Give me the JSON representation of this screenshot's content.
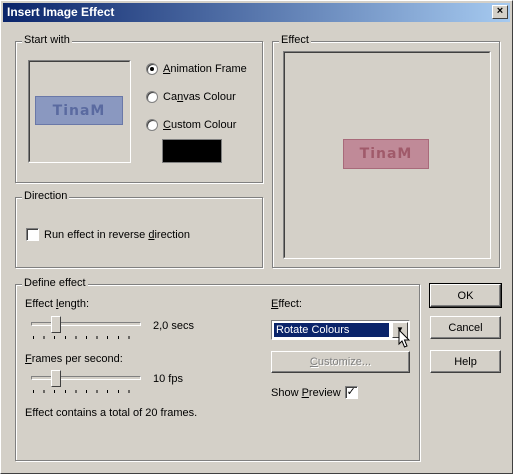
{
  "window": {
    "title": "Insert Image Effect",
    "close_label": "×"
  },
  "start_with": {
    "group_label": "Start with",
    "preview_logo": "TinaM",
    "options": [
      {
        "pre": "",
        "key": "A",
        "post": "nimation Frame",
        "checked": true
      },
      {
        "pre": "Ca",
        "key": "n",
        "post": "vas Colour",
        "checked": false
      },
      {
        "pre": "",
        "key": "C",
        "post": "ustom Colour",
        "checked": false
      }
    ],
    "custom_colour": "#000000"
  },
  "effect_panel": {
    "group_label": "Effect",
    "preview_logo": "TinaM"
  },
  "direction": {
    "group_label": "Direction",
    "reverse_pre": "Run effect in reverse ",
    "reverse_key": "d",
    "reverse_post": "irection",
    "reverse_checked": false
  },
  "define_effect": {
    "group_label": "Define effect",
    "length_label_pre": "Effect ",
    "length_label_key": "l",
    "length_label_post": "ength:",
    "length_value": "2,0 secs",
    "length_slider_fraction": 0.2,
    "fps_label_key": "F",
    "fps_label_post": "rames per second:",
    "fps_value": "10 fps",
    "fps_slider_fraction": 0.2,
    "total_frames_text": "Effect contains a total of 20 frames.",
    "effect_label_key": "E",
    "effect_label_post": "ffect:",
    "effect_selected": "Rotate Colours",
    "customize_key": "C",
    "customize_post": "ustomize...",
    "show_preview_pre": "Show ",
    "show_preview_key": "P",
    "show_preview_post": "review",
    "show_preview_checked": true
  },
  "buttons": {
    "ok": "OK",
    "cancel": "Cancel",
    "help": "Help"
  },
  "colors": {
    "dialog_bg": "#d4d0c8",
    "titlebar_start": "#0a246a",
    "titlebar_end": "#a6caf0",
    "logo_start_bg": "#8a98c0",
    "logo_start_text": "#5a6aa0",
    "logo_effect_bg": "#c08a98",
    "logo_effect_text": "#a05a6a"
  },
  "icons": {
    "close": "close-icon",
    "dropdown": "chevron-down-icon",
    "cursor": "mouse-pointer-icon"
  }
}
